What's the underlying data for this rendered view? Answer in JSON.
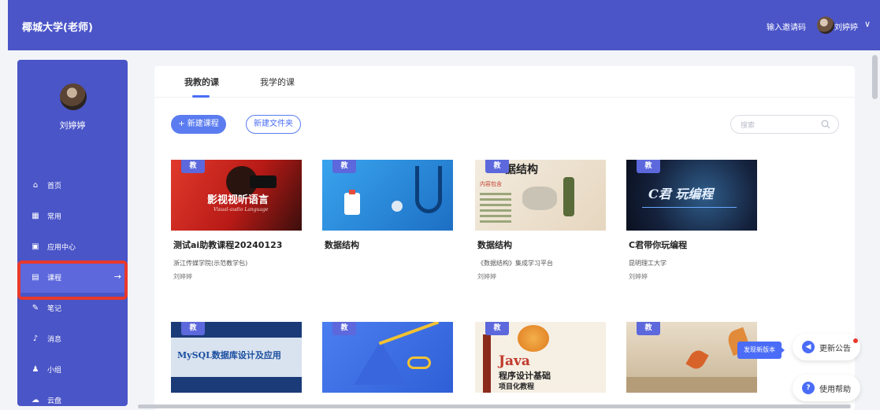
{
  "header": {
    "brand": "椰城大学(老师)",
    "invite_label": "输入邀请码",
    "user_name": "刘婷婷",
    "chevron": "∨"
  },
  "sidebar": {
    "user_name": "刘婷婷",
    "items": [
      {
        "label": "首页",
        "icon": "home-icon",
        "glyph": "⌂"
      },
      {
        "label": "常用",
        "icon": "grid-icon",
        "glyph": "▦"
      },
      {
        "label": "应用中心",
        "icon": "apps-icon",
        "glyph": "▣"
      },
      {
        "label": "课程",
        "icon": "course-icon",
        "glyph": "▤",
        "arrow": "→"
      },
      {
        "label": "笔记",
        "icon": "note-icon",
        "glyph": "✎"
      },
      {
        "label": "消息",
        "icon": "bell-icon",
        "glyph": "♪"
      },
      {
        "label": "小组",
        "icon": "group-icon",
        "glyph": "♟"
      },
      {
        "label": "云盘",
        "icon": "cloud-icon",
        "glyph": "☁"
      }
    ],
    "active_item": "课程"
  },
  "tabs": [
    {
      "label": "我教的课",
      "active": true
    },
    {
      "label": "我学的课",
      "active": false
    }
  ],
  "actions": {
    "new_course": "+ 新建课程",
    "new_folder": "新建文件夹",
    "search_placeholder": "搜索"
  },
  "courses": [
    {
      "badge": "教",
      "title": "测试ai助教课程20240123",
      "org": "浙江传媒学院(示范教学包)",
      "teacher": "刘婷婷",
      "thumb_text": "影视视听语言",
      "thumb_sub": "Visual-audio Language",
      "thumb_color": "#c8231c"
    },
    {
      "badge": "教",
      "title": "数据结构",
      "org": "",
      "teacher": "",
      "thumb_color": "#2f8fd8"
    },
    {
      "badge": "教",
      "title": "数据结构",
      "org": "《数据结构》集成学习平台",
      "teacher": "刘婷婷",
      "thumb_text": "据结构",
      "thumb_sub": "内容包含",
      "thumb_color": "#efe4d2"
    },
    {
      "badge": "教",
      "title": "C君带你玩编程",
      "org": "昆明理工大学",
      "teacher": "刘婷婷",
      "thumb_text": "C君 玩编程",
      "thumb_color": "#1b2a4a"
    },
    {
      "badge": "教",
      "title": "",
      "org": "",
      "teacher": "",
      "thumb_text": "MySQL数据库设计及应用",
      "thumb_color": "#1d3f7a"
    },
    {
      "badge": "教",
      "title": "",
      "org": "",
      "teacher": "",
      "thumb_color": "#3e6ee0"
    },
    {
      "badge": "教",
      "title": "",
      "org": "",
      "teacher": "",
      "thumb_text": "Java",
      "thumb_sub": "程序设计基础",
      "thumb_sub2": "项目化教程",
      "thumb_color": "#f6efe4"
    },
    {
      "badge": "教",
      "title": "",
      "org": "",
      "teacher": "",
      "thumb_color": "#d8c6ae"
    }
  ],
  "floating": {
    "new_version": "发现新版本",
    "announcement": "更新公告",
    "help": "使用帮助"
  }
}
